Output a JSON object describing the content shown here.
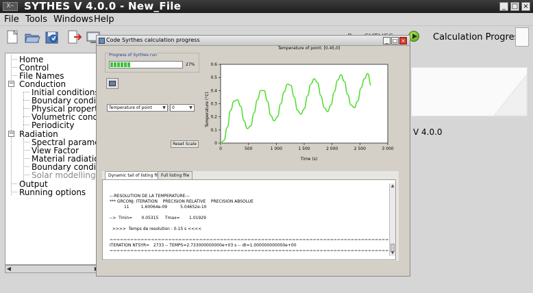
{
  "window": {
    "app_icon_text": "X~",
    "title": "SYTHES V 4.0.0 - New_File"
  },
  "window_buttons": {
    "minimize": "_",
    "maximize": "□",
    "close": "×"
  },
  "menu": [
    {
      "label": "File"
    },
    {
      "label": "Tools"
    },
    {
      "label": "Windows"
    },
    {
      "label": "Help"
    }
  ],
  "toolbar": {
    "icons": [
      "new-file-icon",
      "open-folder-icon",
      "save-icon",
      "export-icon",
      "calculation-icon"
    ],
    "partial_label": "Run SYTHES",
    "run_icon": "play-icon",
    "calc_progress_label": "Calculation Progress"
  },
  "tree": {
    "items": [
      {
        "label": "Home",
        "level": 0
      },
      {
        "label": "Control",
        "level": 0
      },
      {
        "label": "File Names",
        "level": 0
      },
      {
        "label": "Conduction",
        "level": 0,
        "expander": "⊟"
      },
      {
        "label": "Initial conditions",
        "level": 1
      },
      {
        "label": "Boundary conditions",
        "level": 1
      },
      {
        "label": "Physical properties",
        "level": 1
      },
      {
        "label": "Volumetric conditions",
        "level": 1
      },
      {
        "label": "Periodicity",
        "level": 1
      },
      {
        "label": "Radiation",
        "level": 0,
        "expander": "⊟"
      },
      {
        "label": "Spectral parameters",
        "level": 1
      },
      {
        "label": "View Factor",
        "level": 1
      },
      {
        "label": "Material radiation properties",
        "level": 1
      },
      {
        "label": "Boundary conditions",
        "level": 1
      },
      {
        "label": "Solar modelling",
        "level": 1,
        "dim": true
      },
      {
        "label": "Output",
        "level": 0
      },
      {
        "label": "Running options",
        "level": 0
      }
    ],
    "scroll_left": "◀",
    "scroll_right": "▶"
  },
  "right_panel": {
    "version": "V 4.0.0"
  },
  "dialog": {
    "title": "Code Syrthes calculation progress",
    "buttons": {
      "minimize": "_",
      "maximize": "□",
      "close": "×"
    },
    "progress_label": "Progress of Syrthes run",
    "progress_percent_text": "27%",
    "progress_fraction": 0.27,
    "variable_select": "Temperature of point",
    "point_select": "0",
    "reset_scale": "Reset Scale",
    "tabs": [
      {
        "label": "Dynamic tail of listing file",
        "active": true
      },
      {
        "label": "Full listing file",
        "active": false
      }
    ],
    "log_lines": [
      "---RESOLUTION DE LA TEMPERATURE---",
      "*** GRCONJ: ITERATION    PRECISION RELATIVE    PRECISION ABSOLUE",
      "           11         1.60064e-09          5.04652e-10",
      "",
      "-->  Tmin=       0.05315     Tmax=       1.01929",
      "",
      "  >>>>  Temps de resolution : 0.15 s <<<<",
      "",
      "======================================================================================",
      "ITERATION NTSYR=   2733 -- TEMPS=2.733000000000e+03 s -- dt=1.000000000000e+00",
      "======================================================================================"
    ],
    "scroll_up": "▲",
    "scroll_down": "▼"
  },
  "chart_data": {
    "type": "line",
    "title": "Temperature of point: [0.45,0]",
    "xlabel": "Time (s)",
    "ylabel": "Temperature (°C)",
    "xlim": [
      0,
      3000
    ],
    "ylim": [
      0,
      0.6
    ],
    "xticks": [
      0,
      500,
      1000,
      1500,
      2000,
      2500,
      3000
    ],
    "xtick_labels": [
      "0",
      "500",
      "1 000",
      "1 500",
      "2 000",
      "2 500",
      "3 000"
    ],
    "yticks": [
      0,
      0.1,
      0.2,
      0.3,
      0.4,
      0.5,
      0.6
    ],
    "ytick_labels": [
      "0",
      "0.1",
      "0.2",
      "0.3",
      "0.4",
      "0.5",
      "0.6"
    ],
    "grid": false,
    "series": [
      {
        "color": "#55dd33",
        "x": [
          0,
          60,
          120,
          180,
          240,
          300,
          360,
          420,
          480,
          540,
          600,
          660,
          720,
          780,
          840,
          900,
          960,
          1020,
          1080,
          1140,
          1200,
          1260,
          1320,
          1380,
          1440,
          1500,
          1560,
          1620,
          1680,
          1740,
          1800,
          1860,
          1920,
          1980,
          2040,
          2100,
          2160,
          2220,
          2280,
          2340,
          2400,
          2460,
          2520,
          2580,
          2640,
          2700
        ],
        "y": [
          0.0,
          0.02,
          0.12,
          0.25,
          0.32,
          0.33,
          0.28,
          0.17,
          0.11,
          0.13,
          0.23,
          0.33,
          0.4,
          0.4,
          0.32,
          0.21,
          0.17,
          0.2,
          0.3,
          0.39,
          0.45,
          0.44,
          0.35,
          0.25,
          0.22,
          0.26,
          0.36,
          0.45,
          0.49,
          0.46,
          0.36,
          0.27,
          0.24,
          0.29,
          0.39,
          0.48,
          0.52,
          0.47,
          0.37,
          0.29,
          0.27,
          0.32,
          0.42,
          0.49,
          0.53,
          0.44
        ]
      }
    ]
  }
}
